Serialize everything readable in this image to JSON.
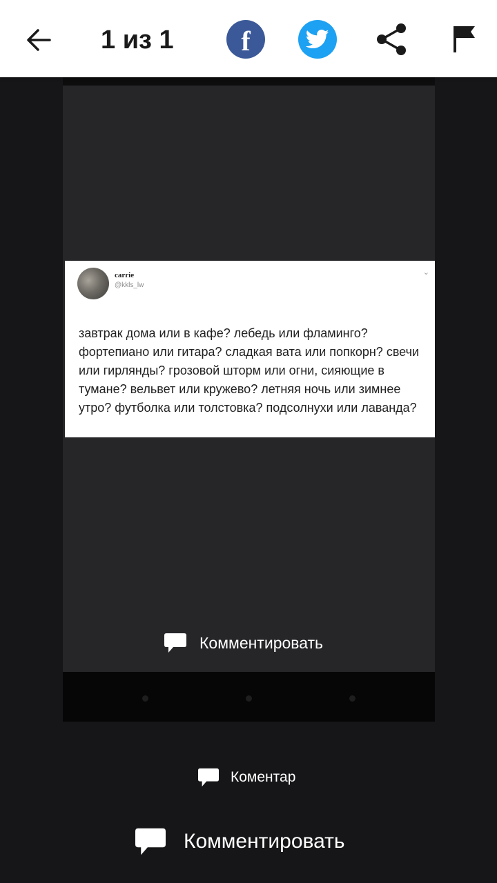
{
  "header": {
    "counter": "1 из 1",
    "icons": [
      "back-arrow-icon",
      "facebook-icon",
      "twitter-icon",
      "share-icon",
      "flag-icon"
    ],
    "colors": {
      "background": "#ffffff",
      "facebook": "#3b5998",
      "twitter": "#1da1f2"
    }
  },
  "screenshot": {
    "tweet": {
      "name": "carrie",
      "handle": "@kkls_lw",
      "text": "завтрак дома или в кафе? лебедь или фламинго? фортепиано или гитара? сладкая вата или попкорн? свечи или гирлянды? грозовой шторм или огни, сияющие в тумане? вельвет или кружево? летняя ночь или зимнее утро? футболка или толстовка? подсолнухи или лаванда?"
    },
    "comment_label": "Комментировать"
  },
  "comment_small": {
    "label": "Коментар",
    "icon": "speech-bubble-icon"
  },
  "comment_large": {
    "label": "Комментировать",
    "icon": "speech-bubble-icon"
  },
  "colors": {
    "page_background": "#161517",
    "screenshot_background": "#262528"
  }
}
